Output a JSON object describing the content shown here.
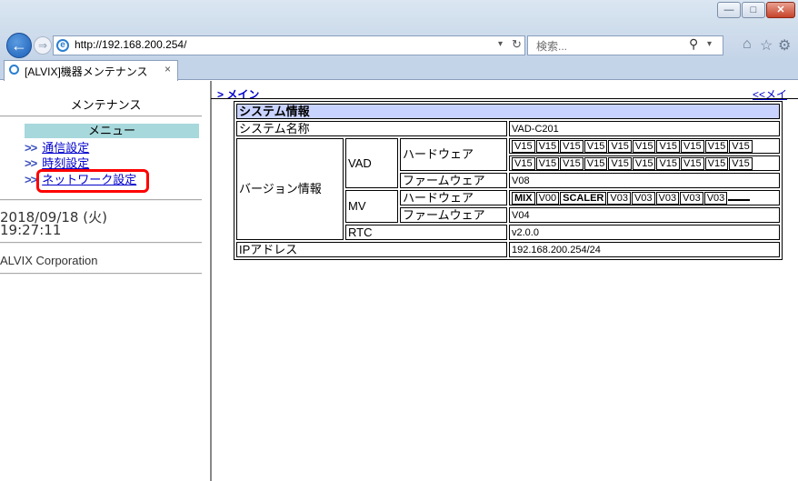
{
  "browser": {
    "url": "http://192.168.200.254/",
    "search_placeholder": "検索...",
    "tab_title": "[ALVIX]機器メンテナンス",
    "tab_close": "×"
  },
  "left": {
    "title": "メンテナンス",
    "menu_header": "メニュー",
    "menu_arrow": ">>",
    "menu_items": [
      "通信設定",
      "時刻設定",
      "ネットワーク設定"
    ],
    "date": "2018/09/18 (火)",
    "time": "19:27:11",
    "company": "ALVIX Corporation"
  },
  "right": {
    "breadcrumb": "> メイン",
    "back_link": "<<メイン",
    "table": {
      "section_title": "システム情報",
      "system_name_label": "システム名称",
      "system_name_value": "VAD-C201",
      "version_label": "バージョン情報",
      "vad_label": "VAD",
      "hardware_label": "ハードウェア",
      "firmware_label": "ファームウェア",
      "vad_hw_row1": [
        "V15",
        "V15",
        "V15",
        "V15",
        "V15",
        "V15",
        "V15",
        "V15",
        "V15",
        "V15"
      ],
      "vad_hw_row2": [
        "V15",
        "V15",
        "V15",
        "V15",
        "V15",
        "V15",
        "V15",
        "V15",
        "V15",
        "V15"
      ],
      "vad_fw": "V08",
      "mv_label": "MV",
      "mv_hw": [
        "MIX",
        "V00",
        "SCALER",
        "V03",
        "V03",
        "V03",
        "V03",
        "V03",
        ""
      ],
      "mv_fw": "V04",
      "rtc_label": "RTC",
      "rtc_value": "v2.0.0",
      "ip_label": "IPアドレス",
      "ip_value": "192.168.200.254/24"
    }
  }
}
